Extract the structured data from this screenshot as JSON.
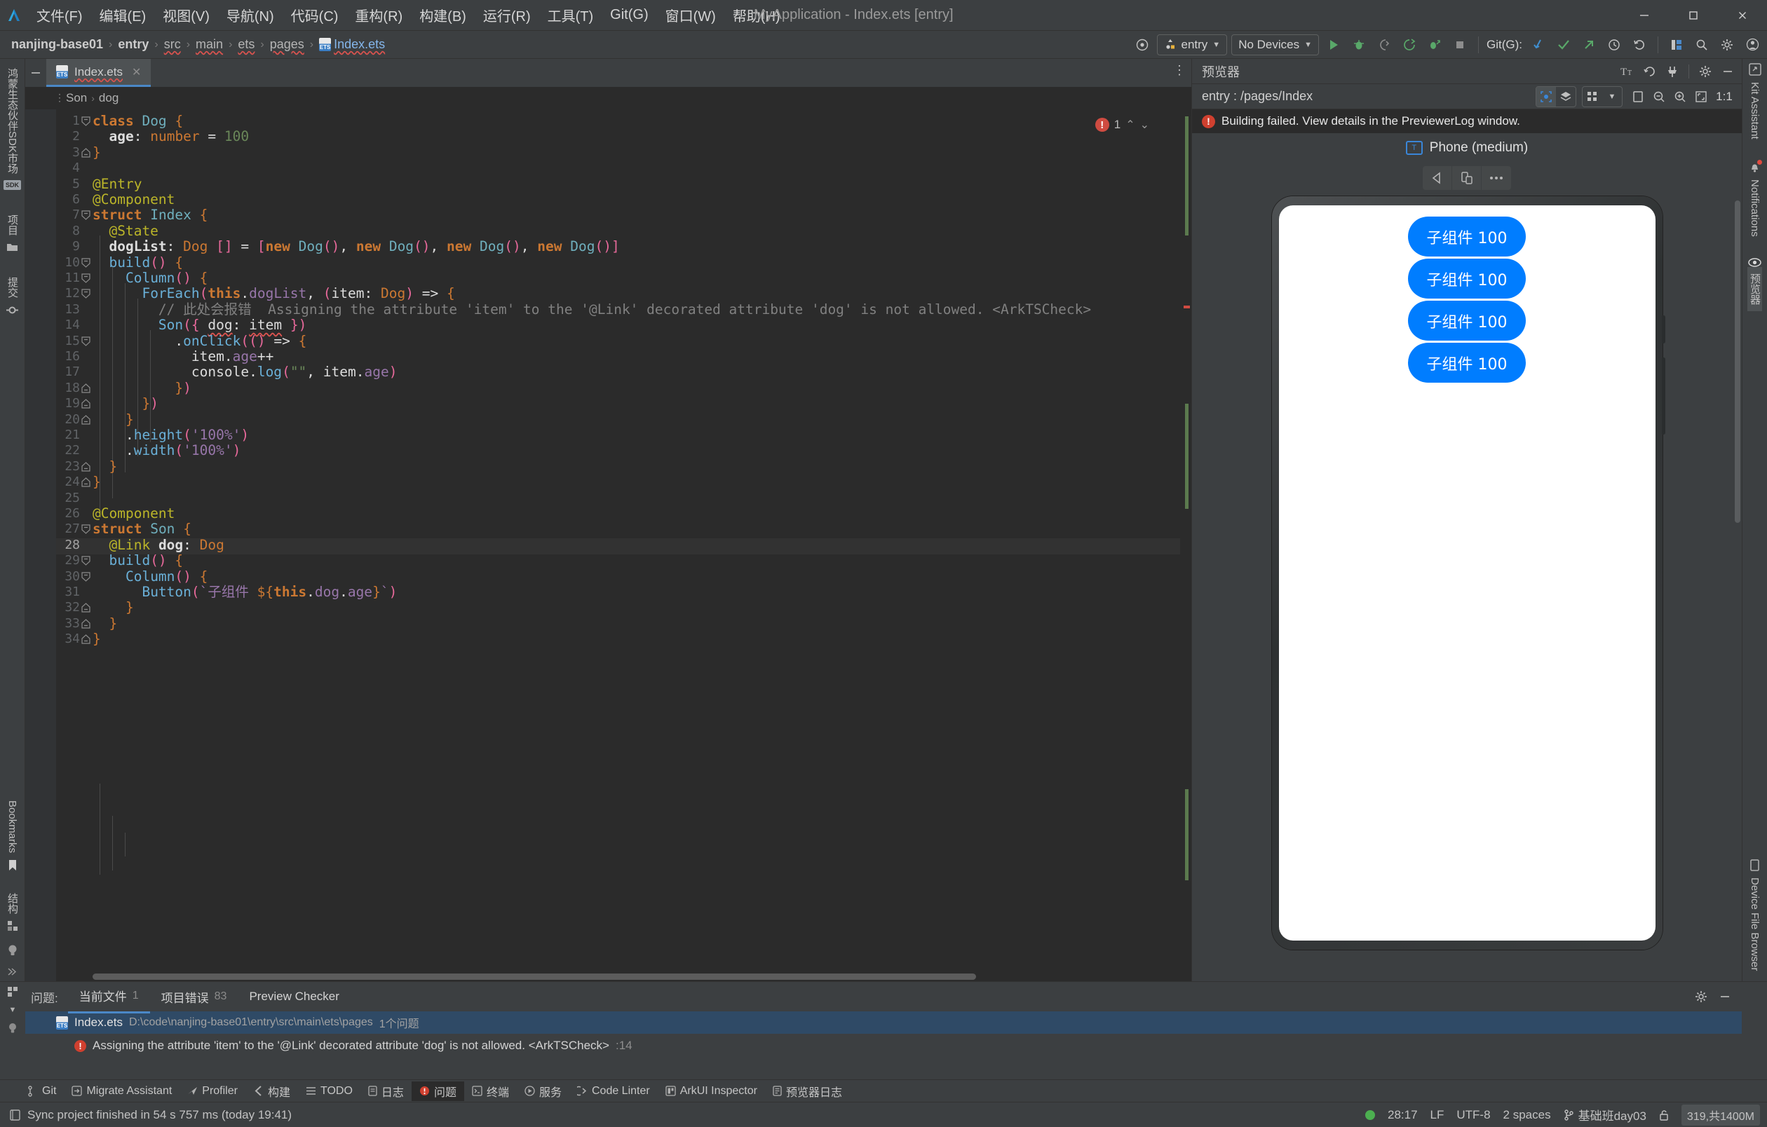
{
  "titlebar": {
    "logo": "deveco-logo-icon",
    "menus": [
      "文件(F)",
      "编辑(E)",
      "视图(V)",
      "导航(N)",
      "代码(C)",
      "重构(R)",
      "构建(B)",
      "运行(R)",
      "工具(T)",
      "Git(G)",
      "窗口(W)",
      "帮助(H)"
    ],
    "window_title": "MyApplication - Index.ets [entry]",
    "minimize": "—",
    "maximize": "▢",
    "close": "✕"
  },
  "navbar": {
    "breadcrumb": [
      "nanjing-base01",
      "entry",
      "src",
      "main",
      "ets",
      "pages",
      "Index.ets"
    ],
    "settings_icon": "gear-target-icon",
    "run_config": "entry",
    "device_select": "No Devices",
    "git_label": "Git(G):",
    "run": "▶",
    "debug": "debug-icon",
    "coverage": "coverage-icon",
    "rerun": "rerun-icon",
    "profile": "profile-icon",
    "stop": "■",
    "git_update": "git-update-icon",
    "git_commit": "git-commit-icon",
    "git_push": "git-push-icon",
    "git_history": "git-history-icon",
    "git_rollback": "git-rollback-icon",
    "layout_icon": "layout-icon",
    "search_icon": "search-icon",
    "settings2_icon": "settings-icon",
    "account_icon": "account-icon"
  },
  "left_strip": {
    "items": [
      {
        "label": "鸿蒙生态伙伴SDK市场",
        "icon": "sdk-chip"
      },
      {
        "label": "项目",
        "icon": "folder-icon"
      },
      {
        "label": "提交",
        "icon": "commit-icon"
      }
    ],
    "bottom": [
      {
        "label": "Bookmarks",
        "icon": "bookmark-icon"
      },
      {
        "label": "结构",
        "icon": "structure-icon"
      },
      {
        "label": "",
        "icon": "lightbulb-icon"
      },
      {
        "label": "",
        "icon": "chevron-double-icon"
      }
    ]
  },
  "right_strip": {
    "items": [
      {
        "label": "Kit Assistant",
        "icon": "kit-assistant-icon"
      },
      {
        "label": "Notifications",
        "icon": "bell-icon"
      },
      {
        "label": "预览器",
        "icon": "eye-icon"
      }
    ],
    "bottom": [
      {
        "label": "Device File Browser",
        "icon": "device-file-icon"
      }
    ]
  },
  "editor": {
    "tab": {
      "label": "Index.ets",
      "badge": "ETS",
      "close": "✕"
    },
    "breadcrumb": [
      "Son",
      "dog"
    ],
    "error_count": "1",
    "lines": [
      {
        "n": 1,
        "html": "<span class=\"kw\">class</span> <span class=\"cls\">Dog</span> <span class=\"brk1\">{</span>"
      },
      {
        "n": 2,
        "html": "  <span class=\"field\">age</span><span class=\"white\">:</span> <span class=\"org\">number</span> <span class=\"white\">=</span> <span class=\"num\">100</span>"
      },
      {
        "n": 3,
        "html": "<span class=\"brk1\">}</span>"
      },
      {
        "n": 4,
        "html": ""
      },
      {
        "n": 5,
        "html": "<span class=\"anno\">@Entry</span>"
      },
      {
        "n": 6,
        "html": "<span class=\"anno\">@Component</span>"
      },
      {
        "n": 7,
        "html": "<span class=\"kw\">struct</span> <span class=\"cls\">Index</span> <span class=\"brk1\">{</span>"
      },
      {
        "n": 8,
        "html": "  <span class=\"anno\">@State</span>"
      },
      {
        "n": 9,
        "html": "  <span class=\"field\">dogList</span><span class=\"white\">:</span> <span class=\"org\">Dog</span> <span class=\"pnk\">[]</span> <span class=\"white\">=</span> <span class=\"pnk\">[</span><span class=\"kw\">new</span> <span class=\"cls\">Dog</span><span class=\"pnk\">()</span><span class=\"white\">,</span> <span class=\"kw\">new</span> <span class=\"cls\">Dog</span><span class=\"pnk\">()</span><span class=\"white\">,</span> <span class=\"kw\">new</span> <span class=\"cls\">Dog</span><span class=\"pnk\">()</span><span class=\"white\">,</span> <span class=\"kw\">new</span> <span class=\"cls\">Dog</span><span class=\"pnk\">()]</span>"
      },
      {
        "n": 10,
        "html": "  <span class=\"blu\">build</span><span class=\"pnk\">()</span> <span class=\"brk1\">{</span>"
      },
      {
        "n": 11,
        "html": "    <span class=\"blu\">Column</span><span class=\"pnk\">()</span> <span class=\"brk1\">{</span>"
      },
      {
        "n": 12,
        "html": "      <span class=\"blu\">ForEach</span><span class=\"pnk\">(</span><span class=\"kw\">this</span><span class=\"white\">.</span><span class=\"prp\">dogList</span><span class=\"white\">,</span> <span class=\"pnk\">(</span><span class=\"white\">item</span><span class=\"white\">:</span> <span class=\"org\">Dog</span><span class=\"pnk\">)</span> <span class=\"white\">=&gt;</span> <span class=\"brk1\">{</span>"
      },
      {
        "n": 13,
        "html": "        <span class=\"cmt\">// 此处会报错  Assigning the attribute 'item' to the '@Link' decorated attribute 'dog' is not allowed. &lt;ArkTSCheck&gt;</span>"
      },
      {
        "n": 14,
        "html": "        <span class=\"blu\">Son</span><span class=\"pnk\">({</span> <span class=\"white wavy\">dog</span><span class=\"white\">:</span> <span class=\"white wavy\">item</span> <span class=\"pnk\">})</span>"
      },
      {
        "n": 15,
        "html": "          <span class=\"white\">.</span><span class=\"blu\">onClick</span><span class=\"pnk\">((</span><span class=\"pnk\">)</span> <span class=\"white\">=&gt;</span> <span class=\"brk1\">{</span>"
      },
      {
        "n": 16,
        "html": "            <span class=\"white\">item</span><span class=\"white\">.</span><span class=\"prp\">age</span><span class=\"white\">++</span>"
      },
      {
        "n": 17,
        "html": "            <span class=\"white\">console</span><span class=\"white\">.</span><span class=\"blu\">log</span><span class=\"pnk\">(</span><span class=\"str\">\"\"</span><span class=\"white\">,</span> <span class=\"white\">item</span><span class=\"white\">.</span><span class=\"prp\">age</span><span class=\"pnk\">)</span>"
      },
      {
        "n": 18,
        "html": "          <span class=\"brk1\">}</span><span class=\"pnk\">)</span>"
      },
      {
        "n": 19,
        "html": "      <span class=\"brk1\">}</span><span class=\"pnk\">)</span>"
      },
      {
        "n": 20,
        "html": "    <span class=\"brk1\">}</span>"
      },
      {
        "n": 21,
        "html": "    <span class=\"white\">.</span><span class=\"blu\">height</span><span class=\"pnk\">(</span><span class=\"prp\">'100%'</span><span class=\"pnk\">)</span>"
      },
      {
        "n": 22,
        "html": "    <span class=\"white\">.</span><span class=\"blu\">width</span><span class=\"pnk\">(</span><span class=\"prp\">'100%'</span><span class=\"pnk\">)</span>"
      },
      {
        "n": 23,
        "html": "  <span class=\"brk1\">}</span>"
      },
      {
        "n": 24,
        "html": "<span class=\"brk1\">}</span>"
      },
      {
        "n": 25,
        "html": ""
      },
      {
        "n": 26,
        "html": "<span class=\"anno\">@Component</span>"
      },
      {
        "n": 27,
        "html": "<span class=\"kw\">struct</span> <span class=\"cls\">Son</span> <span class=\"brk1\">{</span>"
      },
      {
        "n": 28,
        "html": "  <span class=\"anno\">@Link</span> <span class=\"field\">dog</span><span class=\"white\">:</span> <span class=\"org\">Dog</span>"
      },
      {
        "n": 29,
        "html": "  <span class=\"blu\">build</span><span class=\"pnk\">()</span> <span class=\"brk1\">{</span>"
      },
      {
        "n": 30,
        "html": "    <span class=\"blu\">Column</span><span class=\"pnk\">()</span> <span class=\"brk1\">{</span>"
      },
      {
        "n": 31,
        "html": "      <span class=\"blu\">Button</span><span class=\"pnk\">(</span><span class=\"prp\">`子组件 </span><span class=\"org\">${</span><span class=\"kw\">this</span><span class=\"white\">.</span><span class=\"prp\">dog</span><span class=\"white\">.</span><span class=\"prp\">age</span><span class=\"org\">}</span><span class=\"prp\">`</span><span class=\"pnk\">)</span>"
      },
      {
        "n": 32,
        "html": "    <span class=\"brk1\">}</span>"
      },
      {
        "n": 33,
        "html": "  <span class=\"brk1\">}</span>"
      },
      {
        "n": 34,
        "html": "<span class=\"brk1\">}</span>"
      }
    ],
    "current_line": 28
  },
  "previewer": {
    "title": "预览器",
    "head_icons": [
      "text-size-icon",
      "refresh-icon",
      "plug-icon",
      "gear-icon",
      "minimize-icon"
    ],
    "path": "entry : /pages/Index",
    "sub_icons": [
      "inspector-icon",
      "layers-icon",
      "grid-icon",
      "chevron-down-icon",
      "frame-icon",
      "zoom-out-icon",
      "zoom-in-icon",
      "fit-icon"
    ],
    "zoom_level": "1:1",
    "error_message": "Building failed. View details in the PreviewerLog window.",
    "device_name": "Phone (medium)",
    "device_icon": "phone-profile-icon",
    "controls": [
      "rotate-left-icon",
      "multi-device-icon",
      "more-icon"
    ],
    "phone_buttons": [
      "子组件 100",
      "子组件 100",
      "子组件 100",
      "子组件 100"
    ]
  },
  "problems": {
    "panel_label": "问题:",
    "tabs": [
      {
        "label": "当前文件",
        "count": "1",
        "selected": true
      },
      {
        "label": "项目错误",
        "count": "83",
        "selected": false
      },
      {
        "label": "Preview Checker",
        "count": "",
        "selected": false
      }
    ],
    "file_row": {
      "name": "Index.ets",
      "badge": "ETS",
      "path": "D:\\code\\nanjing-base01\\entry\\src\\main\\ets\\pages",
      "count": "1个问题"
    },
    "message": "Assigning the attribute 'item' to the '@Link' decorated attribute 'dog' is not allowed. <ArkTSCheck>",
    "message_line": ":14",
    "tools": [
      "settings-icon",
      "minimize-icon"
    ]
  },
  "tool_window_bar": {
    "items": [
      {
        "label": "Git",
        "icon": "git-branch-icon",
        "selected": false
      },
      {
        "label": "Migrate Assistant",
        "icon": "migrate-icon",
        "selected": false
      },
      {
        "label": "Profiler",
        "icon": "profiler-icon",
        "selected": false
      },
      {
        "label": "构建",
        "icon": "build-icon",
        "selected": false
      },
      {
        "label": "TODO",
        "icon": "todo-icon",
        "selected": false
      },
      {
        "label": "日志",
        "icon": "log-icon",
        "selected": false
      },
      {
        "label": "问题",
        "icon": "problems-icon",
        "selected": true
      },
      {
        "label": "终端",
        "icon": "terminal-icon",
        "selected": false
      },
      {
        "label": "服务",
        "icon": "services-icon",
        "selected": false
      },
      {
        "label": "Code Linter",
        "icon": "linter-icon",
        "selected": false
      },
      {
        "label": "ArkUI Inspector",
        "icon": "inspector-icon",
        "selected": false
      },
      {
        "label": "预览器日志",
        "icon": "preview-log-icon",
        "selected": false
      }
    ]
  },
  "statusbar": {
    "message": "Sync project finished in 54 s 757 ms (today 19:41)",
    "message_icon": "event-log-icon",
    "caret": "28:17",
    "line_sep": "LF",
    "encoding": "UTF-8",
    "indent": "2 spaces",
    "branch": "基础班day03",
    "branch_icon": "git-branch-icon",
    "lock_icon": "unlocked-icon",
    "memory": "319,共1400M"
  },
  "colors": {
    "accent_blue": "#4a88c7",
    "button_blue": "#007dff",
    "error_red": "#d0402f",
    "bg_panel": "#3c3f41",
    "bg_editor": "#2b2b2b"
  }
}
